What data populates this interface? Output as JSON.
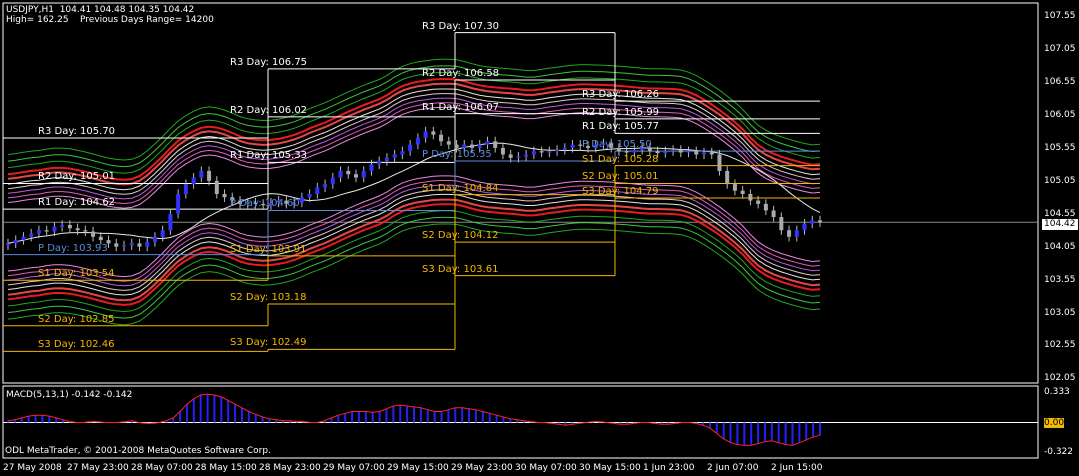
{
  "header": {
    "line1": "USDJPY,H1  104.41 104.48 104.35 104.42",
    "line2": "High= 162.25    Previous Days Range= 14200"
  },
  "macd": {
    "label": "MACD(5,13,1) -0.142 -0.142",
    "ticks": [
      "0.333",
      "0.00",
      "-0.322"
    ],
    "values": [
      0.02,
      0.03,
      0.05,
      0.07,
      0.08,
      0.08,
      0.07,
      0.05,
      0.03,
      0.01,
      0.0,
      0.0,
      0.01,
      0.01,
      0.0,
      0.0,
      0.0,
      0.01,
      0.02,
      0.0,
      -0.01,
      -0.01,
      0.0,
      0.02,
      0.05,
      0.12,
      0.2,
      0.26,
      0.3,
      0.31,
      0.3,
      0.28,
      0.24,
      0.2,
      0.16,
      0.12,
      0.09,
      0.06,
      0.04,
      0.03,
      0.02,
      0.02,
      0.01,
      0.01,
      0.0,
      0.0,
      0.02,
      0.05,
      0.08,
      0.1,
      0.12,
      0.12,
      0.12,
      0.11,
      0.12,
      0.15,
      0.18,
      0.19,
      0.18,
      0.17,
      0.16,
      0.14,
      0.12,
      0.12,
      0.14,
      0.16,
      0.16,
      0.15,
      0.14,
      0.12,
      0.1,
      0.08,
      0.06,
      0.04,
      0.03,
      0.02,
      0.01,
      0.0,
      0.0,
      -0.01,
      -0.02,
      -0.03,
      -0.02,
      -0.01,
      0.0,
      0.01,
      0.01,
      0.0,
      -0.01,
      -0.02,
      -0.02,
      -0.01,
      0.0,
      0.0,
      -0.01,
      -0.02,
      -0.02,
      -0.01,
      0.0,
      0.0,
      -0.01,
      -0.03,
      -0.06,
      -0.12,
      -0.18,
      -0.22,
      -0.24,
      -0.25,
      -0.25,
      -0.23,
      -0.21,
      -0.2,
      -0.22,
      -0.24,
      -0.25,
      -0.22,
      -0.19,
      -0.16,
      -0.14
    ]
  },
  "credit": "ODL MetaTrader, © 2001-2008 MetaQuotes Software Corp.",
  "current_price": "104.42",
  "price_axis": {
    "ticks": [
      "107.55",
      "107.05",
      "106.55",
      "106.05",
      "105.55",
      "105.05",
      "104.55",
      "104.05",
      "103.55",
      "103.05",
      "102.55",
      "102.05"
    ]
  },
  "time_axis": {
    "ticks": [
      "27 May 2008",
      "27 May 23:00",
      "28 May 07:00",
      "28 May 15:00",
      "28 May 23:00",
      "29 May 07:00",
      "29 May 15:00",
      "29 May 23:00",
      "30 May 07:00",
      "30 May 15:00",
      "1 Jun 23:00",
      "2 Jun 07:00",
      "2 Jun 15:00"
    ]
  },
  "pivots": [
    {
      "day": 1,
      "levels": [
        {
          "label": "R3 Day: 105.70",
          "color": "#ffffff"
        },
        {
          "label": "R2 Day: 105.01",
          "color": "#ffffff"
        },
        {
          "label": "R1 Day: 104.62",
          "color": "#ffffff"
        },
        {
          "label": "P Day: 103.93",
          "color": "#5b8bd9"
        },
        {
          "label": "S1 Day: 103.54",
          "color": "#f5b800"
        },
        {
          "label": "S2 Day: 102.85",
          "color": "#f5b800"
        },
        {
          "label": "S3 Day: 102.46",
          "color": "#f5b800"
        }
      ]
    },
    {
      "day": 2,
      "levels": [
        {
          "label": "R3 Day: 106.75",
          "color": "#ffffff"
        },
        {
          "label": "R2 Day: 106.02",
          "color": "#ffffff"
        },
        {
          "label": "R1 Day: 105.33",
          "color": "#ffffff"
        },
        {
          "label": "P Day: 104.60",
          "color": "#5b8bd9"
        },
        {
          "label": "S1 Day: 103.91",
          "color": "#f5b800"
        },
        {
          "label": "S2 Day: 103.18",
          "color": "#f5b800"
        },
        {
          "label": "S3 Day: 102.49",
          "color": "#f5b800"
        }
      ]
    },
    {
      "day": 3,
      "levels": [
        {
          "label": "R3 Day: 107.30",
          "color": "#ffffff"
        },
        {
          "label": "R2 Day: 106.58",
          "color": "#ffffff"
        },
        {
          "label": "R1 Day: 106.07",
          "color": "#ffffff"
        },
        {
          "label": "P Day: 105.35",
          "color": "#5b8bd9"
        },
        {
          "label": "S1 Day: 104.84",
          "color": "#f5b800"
        },
        {
          "label": "S2 Day: 104.12",
          "color": "#f5b800"
        },
        {
          "label": "S3 Day: 103.61",
          "color": "#f5b800"
        }
      ]
    },
    {
      "day": 4,
      "levels": [
        {
          "label": "R3 Day: 106.26",
          "color": "#ffffff"
        },
        {
          "label": "R2 Day: 105.99",
          "color": "#ffffff"
        },
        {
          "label": "R1 Day: 105.77",
          "color": "#ffffff"
        },
        {
          "label": "P Day: 105.50",
          "color": "#5b8bd9"
        },
        {
          "label": "S1 Day: 105.28",
          "color": "#f5b800"
        },
        {
          "label": "S2 Day: 105.01",
          "color": "#f5b800"
        },
        {
          "label": "S3 Day: 104.79",
          "color": "#f5b800"
        }
      ]
    }
  ],
  "chart_data": {
    "type": "candlestick",
    "symbol": "USDJPY",
    "timeframe": "H1",
    "ylim": [
      101.98,
      107.75
    ],
    "close": [
      104.1,
      104.15,
      104.2,
      104.25,
      104.3,
      104.28,
      104.35,
      104.38,
      104.33,
      104.3,
      104.28,
      104.2,
      104.15,
      104.1,
      104.05,
      104.07,
      104.1,
      104.05,
      104.12,
      104.2,
      104.3,
      104.55,
      104.85,
      105.0,
      105.1,
      105.2,
      105.05,
      104.85,
      104.8,
      104.75,
      104.7,
      104.72,
      104.7,
      104.68,
      104.72,
      104.75,
      104.7,
      104.72,
      104.8,
      104.85,
      104.95,
      105.0,
      105.1,
      105.2,
      105.15,
      105.1,
      105.2,
      105.3,
      105.35,
      105.4,
      105.45,
      105.5,
      105.6,
      105.7,
      105.8,
      105.75,
      105.65,
      105.6,
      105.55,
      105.6,
      105.55,
      105.6,
      105.65,
      105.55,
      105.45,
      105.4,
      105.42,
      105.45,
      105.5,
      105.48,
      105.5,
      105.52,
      105.55,
      105.6,
      105.58,
      105.55,
      105.6,
      105.62,
      105.55,
      105.5,
      105.48,
      105.52,
      105.55,
      105.5,
      105.47,
      105.5,
      105.52,
      105.48,
      105.5,
      105.45,
      105.48,
      105.45,
      105.2,
      105.0,
      104.9,
      104.85,
      104.75,
      104.7,
      104.6,
      104.5,
      104.3,
      104.2,
      104.3,
      104.4,
      104.45,
      104.42
    ]
  }
}
